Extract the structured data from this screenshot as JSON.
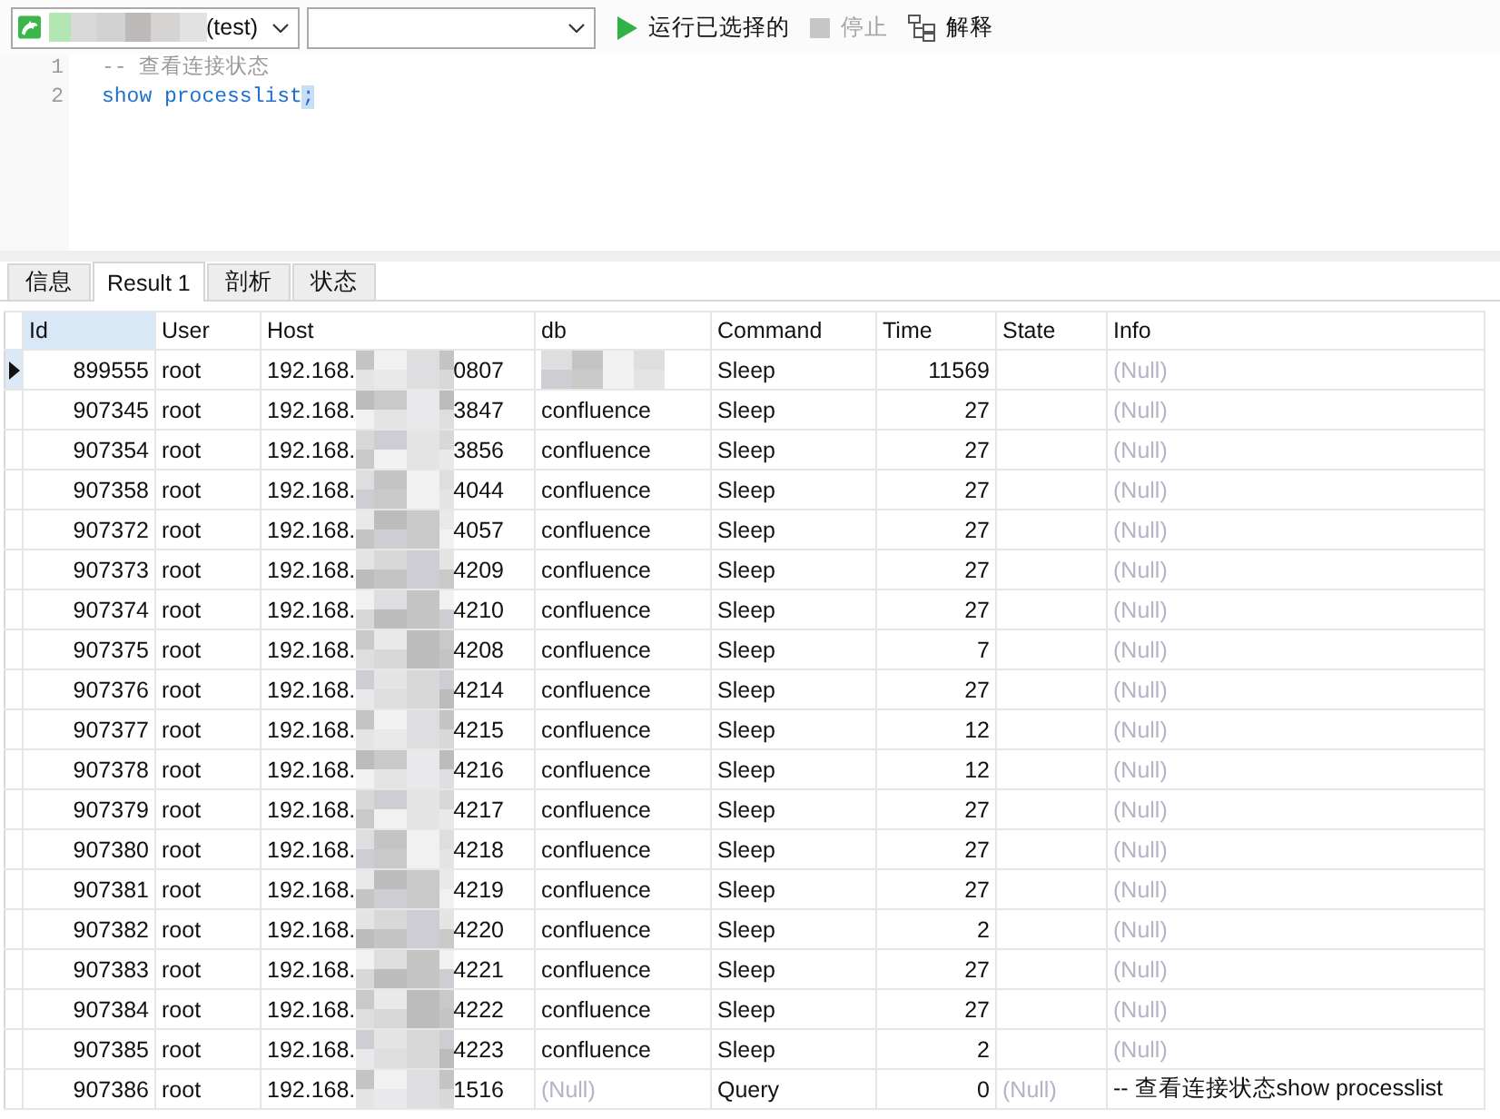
{
  "toolbar": {
    "selects": [
      {
        "kind": "connection",
        "text": "(test)"
      },
      {
        "kind": "empty"
      }
    ],
    "buttons": [
      {
        "kind": "run",
        "label": "运行已选择的",
        "disabled": false
      },
      {
        "kind": "stop",
        "label": "停止",
        "disabled": true
      },
      {
        "kind": "explain",
        "label": "解释",
        "disabled": false
      }
    ]
  },
  "editor": {
    "lines": [
      {
        "number": "1",
        "kind": "comment",
        "text": "-- 查看连接状态"
      },
      {
        "number": "2",
        "kind": "code",
        "text": "show processlist",
        "highlight": ";"
      }
    ]
  },
  "tabs": [
    {
      "label": "信息",
      "selected": false
    },
    {
      "label": "Result 1",
      "selected": true
    },
    {
      "label": "剖析",
      "selected": false
    },
    {
      "label": "状态",
      "selected": false
    }
  ],
  "table": {
    "columns": [
      {
        "label": "Id",
        "kind": "number",
        "selected": true
      },
      {
        "label": "User",
        "kind": "text",
        "selected": false
      },
      {
        "label": "Host",
        "kind": "text",
        "selected": false
      },
      {
        "label": "db",
        "kind": "text",
        "selected": false
      },
      {
        "label": "Command",
        "kind": "text",
        "selected": false
      },
      {
        "label": "Time",
        "kind": "number",
        "selected": false
      },
      {
        "label": "State",
        "kind": "text",
        "selected": false
      },
      {
        "label": "Info",
        "kind": "text",
        "selected": false
      }
    ],
    "rows": [
      {
        "selected": true,
        "cells": [
          "899555",
          "root",
          {
            "kind": "masked",
            "start": "192.168.",
            "end": "0807"
          },
          {
            "kind": "masked"
          },
          "Sleep",
          "11569",
          null,
          {
            "kind": "null",
            "text": "(Null)"
          }
        ]
      },
      {
        "selected": false,
        "cells": [
          "907345",
          "root",
          {
            "kind": "masked",
            "start": "192.168.",
            "end": "3847"
          },
          "confluence",
          "Sleep",
          "27",
          null,
          {
            "kind": "null",
            "text": "(Null)"
          }
        ]
      },
      {
        "selected": false,
        "cells": [
          "907354",
          "root",
          {
            "kind": "masked",
            "start": "192.168.",
            "end": "3856"
          },
          "confluence",
          "Sleep",
          "27",
          null,
          {
            "kind": "null",
            "text": "(Null)"
          }
        ]
      },
      {
        "selected": false,
        "cells": [
          "907358",
          "root",
          {
            "kind": "masked",
            "start": "192.168.",
            "end": "4044"
          },
          "confluence",
          "Sleep",
          "27",
          null,
          {
            "kind": "null",
            "text": "(Null)"
          }
        ]
      },
      {
        "selected": false,
        "cells": [
          "907372",
          "root",
          {
            "kind": "masked",
            "start": "192.168.",
            "end": "4057"
          },
          "confluence",
          "Sleep",
          "27",
          null,
          {
            "kind": "null",
            "text": "(Null)"
          }
        ]
      },
      {
        "selected": false,
        "cells": [
          "907373",
          "root",
          {
            "kind": "masked",
            "start": "192.168.",
            "end": "4209"
          },
          "confluence",
          "Sleep",
          "27",
          null,
          {
            "kind": "null",
            "text": "(Null)"
          }
        ]
      },
      {
        "selected": false,
        "cells": [
          "907374",
          "root",
          {
            "kind": "masked",
            "start": "192.168.",
            "end": "4210"
          },
          "confluence",
          "Sleep",
          "27",
          null,
          {
            "kind": "null",
            "text": "(Null)"
          }
        ]
      },
      {
        "selected": false,
        "cells": [
          "907375",
          "root",
          {
            "kind": "masked",
            "start": "192.168.",
            "end": "4208"
          },
          "confluence",
          "Sleep",
          "7",
          null,
          {
            "kind": "null",
            "text": "(Null)"
          }
        ]
      },
      {
        "selected": false,
        "cells": [
          "907376",
          "root",
          {
            "kind": "masked",
            "start": "192.168.",
            "end": "4214"
          },
          "confluence",
          "Sleep",
          "27",
          null,
          {
            "kind": "null",
            "text": "(Null)"
          }
        ]
      },
      {
        "selected": false,
        "cells": [
          "907377",
          "root",
          {
            "kind": "masked",
            "start": "192.168.",
            "end": "4215"
          },
          "confluence",
          "Sleep",
          "12",
          null,
          {
            "kind": "null",
            "text": "(Null)"
          }
        ]
      },
      {
        "selected": false,
        "cells": [
          "907378",
          "root",
          {
            "kind": "masked",
            "start": "192.168.",
            "end": "4216"
          },
          "confluence",
          "Sleep",
          "12",
          null,
          {
            "kind": "null",
            "text": "(Null)"
          }
        ]
      },
      {
        "selected": false,
        "cells": [
          "907379",
          "root",
          {
            "kind": "masked",
            "start": "192.168.",
            "end": "4217"
          },
          "confluence",
          "Sleep",
          "27",
          null,
          {
            "kind": "null",
            "text": "(Null)"
          }
        ]
      },
      {
        "selected": false,
        "cells": [
          "907380",
          "root",
          {
            "kind": "masked",
            "start": "192.168.",
            "end": "4218"
          },
          "confluence",
          "Sleep",
          "27",
          null,
          {
            "kind": "null",
            "text": "(Null)"
          }
        ]
      },
      {
        "selected": false,
        "cells": [
          "907381",
          "root",
          {
            "kind": "masked",
            "start": "192.168.",
            "end": "4219"
          },
          "confluence",
          "Sleep",
          "27",
          null,
          {
            "kind": "null",
            "text": "(Null)"
          }
        ]
      },
      {
        "selected": false,
        "cells": [
          "907382",
          "root",
          {
            "kind": "masked",
            "start": "192.168.",
            "end": "4220"
          },
          "confluence",
          "Sleep",
          "2",
          null,
          {
            "kind": "null",
            "text": "(Null)"
          }
        ]
      },
      {
        "selected": false,
        "cells": [
          "907383",
          "root",
          {
            "kind": "masked",
            "start": "192.168.",
            "end": "4221"
          },
          "confluence",
          "Sleep",
          "27",
          null,
          {
            "kind": "null",
            "text": "(Null)"
          }
        ]
      },
      {
        "selected": false,
        "cells": [
          "907384",
          "root",
          {
            "kind": "masked",
            "start": "192.168.",
            "end": "4222"
          },
          "confluence",
          "Sleep",
          "27",
          null,
          {
            "kind": "null",
            "text": "(Null)"
          }
        ]
      },
      {
        "selected": false,
        "cells": [
          "907385",
          "root",
          {
            "kind": "masked",
            "start": "192.168.",
            "end": "4223"
          },
          "confluence",
          "Sleep",
          "2",
          null,
          {
            "kind": "null",
            "text": "(Null)"
          }
        ]
      },
      {
        "selected": false,
        "cells": [
          "907386",
          "root",
          {
            "kind": "masked",
            "start": "192.168.",
            "end": "1516"
          },
          {
            "kind": "null",
            "text": "(Null)"
          },
          "Query",
          "0",
          {
            "kind": "null",
            "text": "(Null)"
          },
          "-- 查看连接状态show processlist"
        ]
      }
    ]
  }
}
